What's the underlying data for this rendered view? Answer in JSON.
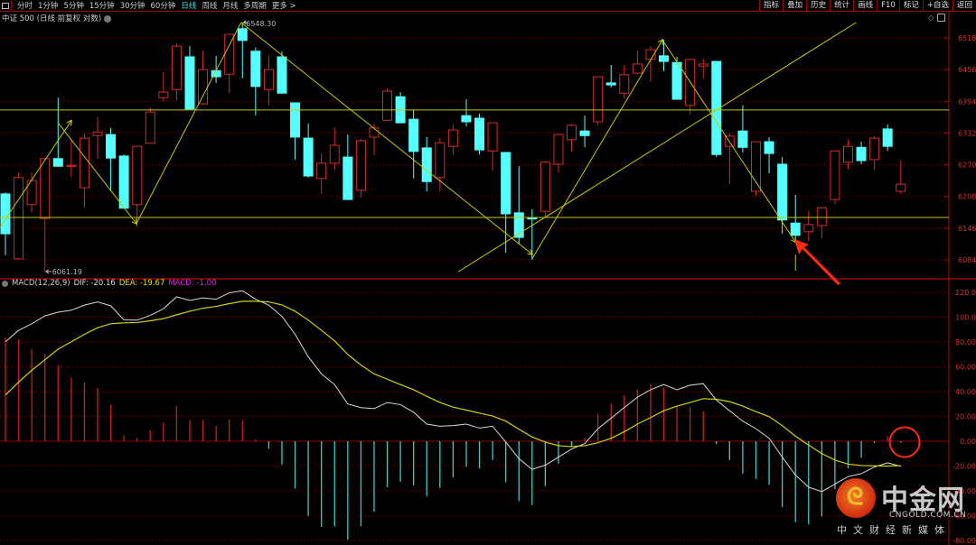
{
  "toolbar": {
    "tabs": [
      "分时",
      "1分钟",
      "5分钟",
      "15分钟",
      "30分钟",
      "60分钟",
      "日线",
      "周线",
      "月线",
      "多周期",
      "更多 >"
    ],
    "active_tab": "日线",
    "right_buttons": [
      "指标",
      "叠加",
      "历史",
      "统计",
      "画线",
      "F10",
      "标记",
      "+自选",
      "返回"
    ]
  },
  "chart_title": "中证 500 (日线 前复权 对数)",
  "macd_header": {
    "name": "MACD(12,26,9)",
    "dif": "DIF: -20.16",
    "dea": "DEA: -19.67",
    "macd": "MACD: -1.00"
  },
  "logo": {
    "name": "中金网",
    "url": "CNGOLD.COM.CN",
    "slogan": "中文财经新媒体"
  },
  "colors": {
    "up": "#d42a2a",
    "down": "#54ffff",
    "dif": "#d8d8d8",
    "dea": "#d4d400",
    "grid": "#7a0000",
    "annotation": "#ff2a10"
  },
  "chart_data": [
    {
      "type": "candlestick",
      "title": "中证 500 (日线 前复权 对数)",
      "y_ticks": [
        "6518",
        "6456",
        "6394",
        "6332",
        "6270",
        "6208",
        "6146",
        "6084"
      ],
      "ylim": [
        6084,
        6518
      ],
      "high_label": "6548.30",
      "low_label": "6061.19",
      "ohlc": [
        [
          6213,
          6216,
          6093,
          6135
        ],
        [
          6086,
          6255,
          6084,
          6245
        ],
        [
          6192,
          6255,
          6177,
          6239
        ],
        [
          6165,
          6283,
          6061,
          6282
        ],
        [
          6282,
          6401,
          6266,
          6267
        ],
        [
          6268,
          6319,
          6246,
          6269
        ],
        [
          6225,
          6331,
          6186,
          6322
        ],
        [
          6327,
          6363,
          6282,
          6334
        ],
        [
          6329,
          6342,
          6218,
          6283
        ],
        [
          6287,
          6290,
          6184,
          6185
        ],
        [
          6192,
          6307,
          6148,
          6306
        ],
        [
          6312,
          6382,
          6311,
          6373
        ],
        [
          6401,
          6451,
          6394,
          6412
        ],
        [
          6417,
          6507,
          6396,
          6502
        ],
        [
          6481,
          6502,
          6378,
          6379
        ],
        [
          6389,
          6493,
          6388,
          6456
        ],
        [
          6454,
          6483,
          6430,
          6442
        ],
        [
          6447,
          6526,
          6410,
          6525
        ],
        [
          6536,
          6548.3,
          6439,
          6513
        ],
        [
          6492,
          6499,
          6366,
          6423
        ],
        [
          6417,
          6483,
          6386,
          6456
        ],
        [
          6481,
          6492,
          6409,
          6410
        ],
        [
          6391,
          6392,
          6280,
          6324
        ],
        [
          6322,
          6350,
          6245,
          6248
        ],
        [
          6243,
          6292,
          6213,
          6273
        ],
        [
          6273,
          6343,
          6260,
          6308
        ],
        [
          6285,
          6329,
          6201,
          6202
        ],
        [
          6220,
          6320,
          6206,
          6317
        ],
        [
          6324,
          6350,
          6289,
          6342
        ],
        [
          6357,
          6419,
          6356,
          6414
        ],
        [
          6403,
          6412,
          6351,
          6352
        ],
        [
          6359,
          6377,
          6243,
          6296
        ],
        [
          6303,
          6324,
          6218,
          6237
        ],
        [
          6245,
          6322,
          6218,
          6313
        ],
        [
          6306,
          6349,
          6290,
          6338
        ],
        [
          6366,
          6398,
          6345,
          6354
        ],
        [
          6361,
          6370,
          6290,
          6299
        ],
        [
          6297,
          6353,
          6259,
          6352
        ],
        [
          6294,
          6295,
          6098,
          6174
        ],
        [
          6176,
          6267,
          6114,
          6128
        ],
        [
          6166,
          6183,
          6084,
          6165
        ],
        [
          6179,
          6278,
          6167,
          6275
        ],
        [
          6271,
          6330,
          6255,
          6329
        ],
        [
          6319,
          6350,
          6296,
          6347
        ],
        [
          6336,
          6366,
          6304,
          6327
        ],
        [
          6354,
          6443,
          6347,
          6442
        ],
        [
          6430,
          6465,
          6421,
          6426
        ],
        [
          6410,
          6465,
          6400,
          6446
        ],
        [
          6449,
          6493,
          6448,
          6467
        ],
        [
          6476,
          6502,
          6433,
          6495
        ],
        [
          6483,
          6514,
          6453,
          6472
        ],
        [
          6470,
          6481,
          6397,
          6398
        ],
        [
          6386,
          6477,
          6368,
          6476
        ],
        [
          6463,
          6477,
          6439,
          6467
        ],
        [
          6472,
          6473,
          6285,
          6290
        ],
        [
          6306,
          6331,
          6232,
          6326
        ],
        [
          6336,
          6386,
          6294,
          6304
        ],
        [
          6218,
          6316,
          6209,
          6315
        ],
        [
          6315,
          6324,
          6253,
          6292
        ],
        [
          6271,
          6285,
          6135,
          6162
        ],
        [
          6156,
          6211,
          6121,
          6132
        ],
        [
          6139,
          6179,
          6121,
          6153
        ],
        [
          6151,
          6187,
          6126,
          6186
        ],
        [
          6202,
          6298,
          6193,
          6297
        ],
        [
          6275,
          6319,
          6262,
          6306
        ],
        [
          6304,
          6315,
          6271,
          6278
        ],
        [
          6280,
          6326,
          6260,
          6322
        ],
        [
          6340,
          6349,
          6297,
          6306
        ],
        [
          6218,
          6278,
          6213,
          6232
        ]
      ],
      "horizontal_lines": [
        6377,
        6167
      ],
      "trendlines": [
        {
          "from": [
            0.6,
            6148
          ],
          "to": [
            6.0,
            6356
          ],
          "arrow": true
        },
        {
          "from": [
            5.0,
            6352
          ],
          "to": [
            10.95,
            6155
          ],
          "arrow": true
        },
        {
          "from": [
            10.95,
            6155
          ],
          "to": [
            18.9,
            6548
          ],
          "arrow": false
        },
        {
          "from": [
            18.9,
            6548
          ],
          "to": [
            41.0,
            6095
          ],
          "arrow": true
        },
        {
          "from": [
            41.0,
            6086
          ],
          "to": [
            50.9,
            6514
          ],
          "arrow": true
        },
        {
          "from": [
            50.9,
            6514
          ],
          "to": [
            61.0,
            6119
          ],
          "arrow": true
        },
        {
          "from": [
            35.4,
            6061
          ],
          "to": [
            65.6,
            6548
          ],
          "arrow": false
        }
      ]
    },
    {
      "type": "macd",
      "title": "MACD(12,26,9)",
      "y_ticks": [
        "120.0",
        "100.0",
        "80.00",
        "60.00",
        "40.00",
        "20.00",
        "0.00",
        "-20.00",
        "-40.00",
        "-60.00",
        "-80.00"
      ],
      "ylim": [
        -80,
        120
      ],
      "histogram": [
        83.8,
        81.9,
        74.6,
        70.5,
        61.4,
        51.2,
        47.3,
        42.8,
        29.2,
        4.6,
        2.9,
        8.7,
        15,
        28.3,
        17.1,
        17.1,
        12.3,
        17.4,
        16.4,
        1.4,
        -6,
        -18.8,
        -38.2,
        -60.4,
        -69,
        -68.6,
        -79.5,
        -68.6,
        -56.8,
        -37.2,
        -32.6,
        -35.7,
        -44.2,
        -37.7,
        -29.2,
        -20.8,
        -21.7,
        -15.2,
        -33.1,
        -48.3,
        -51.4,
        -36.2,
        -18.1,
        -4.3,
        2.9,
        22.2,
        30.4,
        37,
        41.8,
        46.1,
        42.8,
        28.7,
        27.5,
        23.9,
        -2.4,
        -15.2,
        -26.1,
        -30.4,
        -35,
        -53.1,
        -65.4,
        -67.1,
        -60.6,
        -38.6,
        -21.7,
        -13.3,
        -1.4,
        4.1,
        -1.0
      ],
      "dif": [
        80.2,
        89.4,
        94.7,
        101,
        104,
        105.6,
        109.7,
        112.3,
        109.2,
        97.8,
        97.6,
        101.4,
        106.8,
        116.4,
        113.5,
        115.5,
        114.5,
        119.6,
        121.3,
        114.5,
        109.7,
        100.7,
        86.2,
        68.1,
        54.3,
        45.7,
        30,
        27.1,
        26.3,
        31.2,
        29.5,
        23.4,
        13.8,
        12.1,
        12.6,
        13.8,
        10.6,
        12.1,
        -0.7,
        -14,
        -22.7,
        -19.3,
        -12.8,
        -6.3,
        -1.9,
        10.1,
        18.6,
        27.1,
        35.5,
        41.5,
        45.7,
        41.5,
        45.2,
        46.4,
        33.1,
        24.6,
        16.2,
        10.1,
        2.4,
        -12.8,
        -27.3,
        -37,
        -40.6,
        -34.5,
        -28.5,
        -26.1,
        -20.8,
        -17.4,
        -20.16
      ],
      "dea": [
        37.2,
        47.6,
        57.2,
        65.7,
        74.2,
        80.2,
        86.2,
        91.5,
        94.7,
        95.4,
        95.7,
        97.1,
        98.8,
        101.9,
        104.8,
        107.2,
        108.7,
        110.9,
        112.8,
        112.8,
        112.3,
        109.9,
        104.8,
        97.6,
        89.4,
        80.9,
        70,
        61.4,
        54.3,
        50,
        45.7,
        41.5,
        36.2,
        31.2,
        27.5,
        25.1,
        22.7,
        20.3,
        16.2,
        9.7,
        3.4,
        -0.7,
        -3.6,
        -4.3,
        -3.6,
        -1.2,
        2.4,
        7.7,
        13.8,
        19.1,
        24.6,
        28.3,
        31.2,
        34.3,
        33.8,
        31.9,
        28.3,
        23.9,
        19.8,
        12.6,
        4.1,
        -3.1,
        -9.9,
        -15.2,
        -18.4,
        -19.6,
        -19.8,
        -20,
        -19.67
      ]
    }
  ]
}
